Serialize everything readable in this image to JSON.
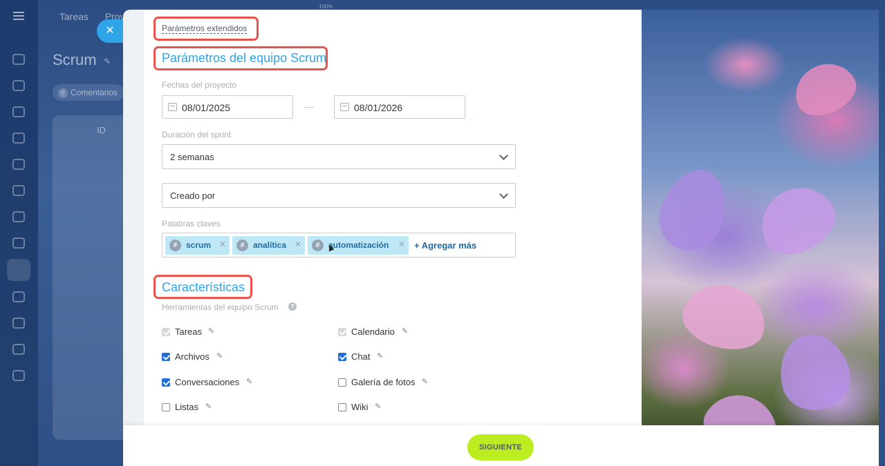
{
  "background": {
    "nav": [
      "Tareas",
      "Prove"
    ],
    "zoom": "100%",
    "page_title": "Scrum",
    "comments_count": "0",
    "comments_label": "Comentarios",
    "table_header": "ID",
    "close_glyph": "✕"
  },
  "form": {
    "extended_link": "Parámetros extendidos",
    "team_params_title": "Parámetros del equipo Scrum",
    "project_dates_label": "Fechas del proyecto",
    "date_start": "08/01/2025",
    "date_end": "08/01/2026",
    "sprint_duration_label": "Duración del sprint",
    "sprint_duration_value": "2 semanas",
    "created_by_value": "Creado por",
    "keywords_label": "Palabras claves",
    "tags": [
      {
        "text": "scrum"
      },
      {
        "text": "analítica"
      },
      {
        "text": "automatización"
      }
    ],
    "add_more": "+ Agregar más",
    "features_title": "Características",
    "tools_label": "Herramientas del equipo Scrum",
    "tools": [
      {
        "label": "Tareas",
        "state": "disabled-checked"
      },
      {
        "label": "Calendario",
        "state": "disabled-checked"
      },
      {
        "label": "Archivos",
        "state": "checked"
      },
      {
        "label": "Chat",
        "state": "checked"
      },
      {
        "label": "Conversaciones",
        "state": "checked"
      },
      {
        "label": "Galería de fotos",
        "state": "unchecked"
      },
      {
        "label": "Listas",
        "state": "unchecked"
      },
      {
        "label": "Wiki",
        "state": "unchecked"
      }
    ]
  },
  "footer": {
    "next_label": "SIGUIENTE"
  },
  "colors": {
    "accent": "#2fa4e7",
    "highlight": "#e8544b",
    "next_button": "#bbed21",
    "checkbox": "#1e6fd9"
  }
}
